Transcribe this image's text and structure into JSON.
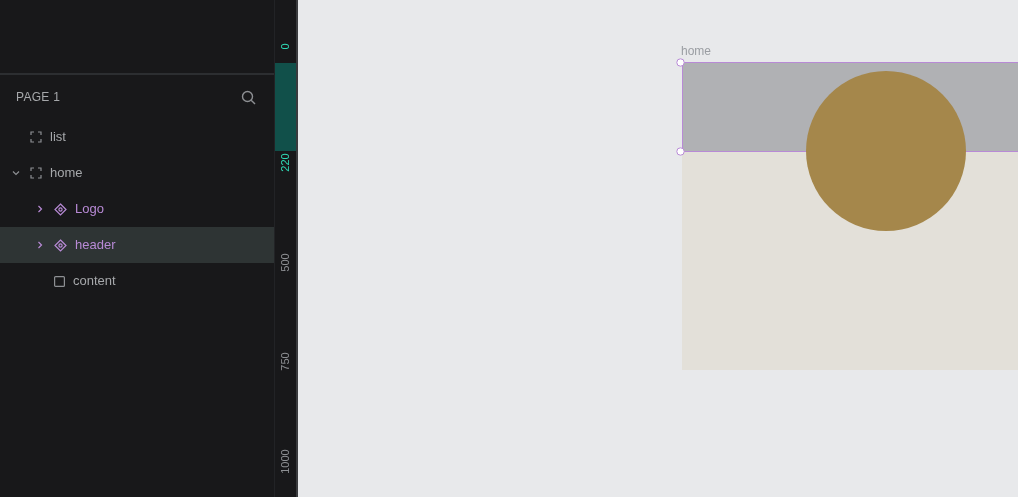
{
  "layers": {
    "title": "PAGE 1",
    "items": [
      {
        "name": "list",
        "kind": "board",
        "selected": false
      },
      {
        "name": "home",
        "kind": "board",
        "selected": false,
        "expanded": true,
        "children": [
          {
            "name": "Logo",
            "kind": "component",
            "selected": false,
            "expanded": false
          },
          {
            "name": "header",
            "kind": "component",
            "selected": true,
            "expanded": false
          },
          {
            "name": "content",
            "kind": "rect",
            "selected": false
          }
        ]
      }
    ]
  },
  "ruler": {
    "labels": [
      {
        "text": "0",
        "highlight": true
      },
      {
        "text": "220",
        "highlight": true
      },
      {
        "text": "500",
        "highlight": false
      },
      {
        "text": "750",
        "highlight": false
      },
      {
        "text": "1000",
        "highlight": false
      }
    ]
  },
  "canvas": {
    "board_label": "home"
  }
}
